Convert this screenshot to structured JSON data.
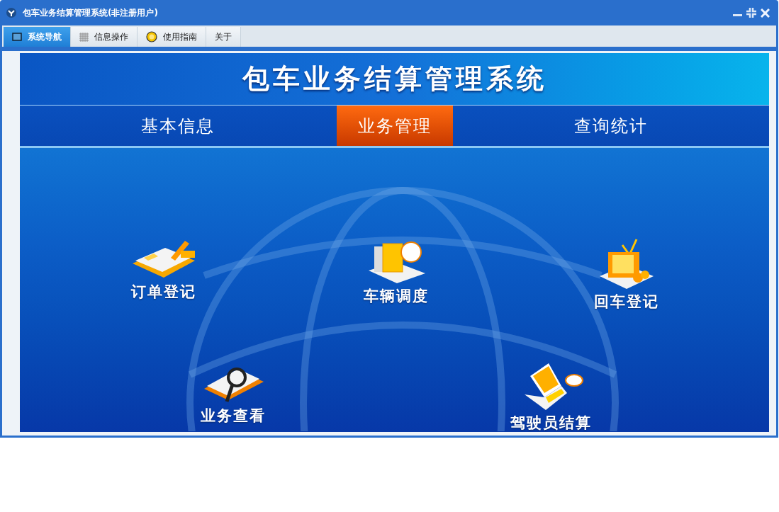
{
  "window": {
    "title": "包车业务结算管理系统(非注册用户)"
  },
  "menu_tabs": [
    {
      "label": "系统导航",
      "selected": true,
      "kind": "monitor"
    },
    {
      "label": "信息操作",
      "selected": false,
      "kind": "grid"
    },
    {
      "label": "使用指南",
      "selected": false,
      "kind": "help"
    },
    {
      "label": "关于",
      "selected": false,
      "kind": "none"
    }
  ],
  "banner": {
    "title": "包车业务结算管理系统"
  },
  "nav": [
    {
      "label": "基本信息",
      "selected": false
    },
    {
      "label": "业务管理",
      "selected": true
    },
    {
      "label": "查询统计",
      "selected": false
    }
  ],
  "functions": [
    {
      "label": "订单登记",
      "kind": "order"
    },
    {
      "label": "车辆调度",
      "kind": "books"
    },
    {
      "label": "回车登记",
      "kind": "tv"
    },
    {
      "label": "业务查看",
      "kind": "magnifier"
    },
    {
      "label": "驾驶员结算",
      "kind": "laptop"
    }
  ]
}
